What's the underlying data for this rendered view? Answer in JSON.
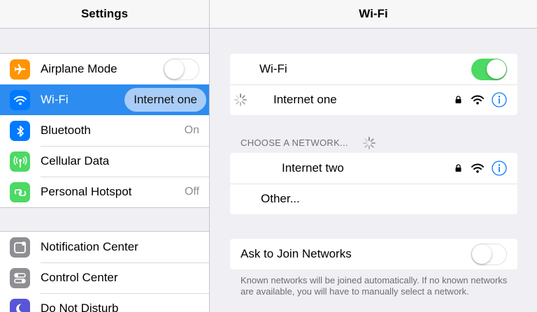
{
  "left": {
    "title": "Settings",
    "group1": [
      {
        "label": "Airplane Mode",
        "icon": "airplane-icon",
        "color": "#ff9500",
        "toggle": false
      },
      {
        "label": "Wi-Fi",
        "icon": "wifi-icon",
        "color": "#007aff",
        "selected": true,
        "bubble": "Internet one"
      },
      {
        "label": "Bluetooth",
        "icon": "bluetooth-icon",
        "color": "#007aff",
        "detail": "On"
      },
      {
        "label": "Cellular Data",
        "icon": "cellular-icon",
        "color": "#4cd964"
      },
      {
        "label": "Personal Hotspot",
        "icon": "hotspot-icon",
        "color": "#4cd964",
        "detail": "Off"
      }
    ],
    "group2": [
      {
        "label": "Notification Center",
        "icon": "notification-center-icon",
        "color": "#8e8e93"
      },
      {
        "label": "Control Center",
        "icon": "control-center-icon",
        "color": "#8e8e93"
      },
      {
        "label": "Do Not Disturb",
        "icon": "moon-icon",
        "color": "#5856d6"
      }
    ]
  },
  "right": {
    "title": "Wi-Fi",
    "wifi_toggle": {
      "label": "Wi-Fi",
      "on": true
    },
    "connected": {
      "name": "Internet one",
      "secured": true
    },
    "section_header": "CHOOSE A NETWORK...",
    "networks": [
      {
        "name": "Internet two",
        "secured": true
      }
    ],
    "other_label": "Other...",
    "ask_to_join": {
      "label": "Ask to Join Networks",
      "on": false
    },
    "footnote": "Known networks will be joined automatically. If no known networks are available, you will have to manually select a network."
  },
  "colors": {
    "accent": "#2d8cf0",
    "toggle_on": "#4cd964",
    "background": "#efeff4"
  }
}
